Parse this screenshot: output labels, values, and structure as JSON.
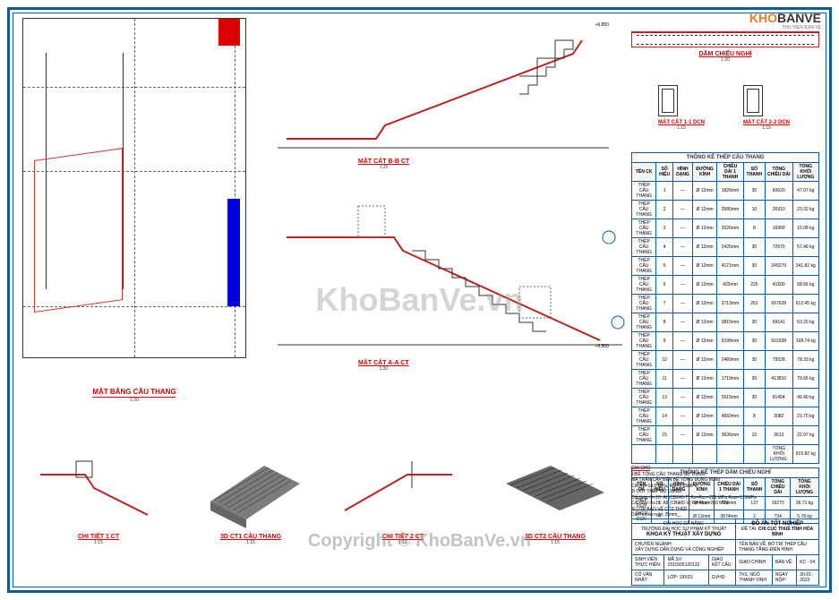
{
  "logo": {
    "part1": "KHO",
    "part2": "BANVE",
    "sub": "THU VIEN BAN VE"
  },
  "watermark1": "KhoBanVe.vn",
  "watermark2": "Copyright © KhoBanVe.vn",
  "plan": {
    "title": "MẶT BẰNG CẦU THANG",
    "scale": "1:20"
  },
  "section_bb": {
    "title": "MẶT CẮT B-B CT",
    "scale": "1:20"
  },
  "section_aa": {
    "title": "MẶT CẮT A-A CT",
    "scale": "1:20"
  },
  "beam": {
    "title": "DẦM CHIẾU NGHỈ",
    "scale": "1:20"
  },
  "sec11": {
    "title": "MẶT CẮT 1-1 DCN",
    "scale": "1:15"
  },
  "sec22": {
    "title": "MẶT CẮT 2-2 DCN",
    "scale": "1:15"
  },
  "detail1": {
    "title": "CHI TIẾT 1 CT",
    "scale": "1:15"
  },
  "detail_3d1": {
    "title": "3D CT1 CẦU THANG",
    "scale": "1:15"
  },
  "detail2": {
    "title": "CHI TIẾT 2 CT",
    "scale": "1:15"
  },
  "detail_3d2": {
    "title": "3D CT2 CẦU THANG",
    "scale": "1:15"
  },
  "level_top": "+6.850",
  "level_bot": "+3.500",
  "table1": {
    "title": "THỐNG KÊ THÉP CẦU THANG",
    "headers": [
      "TÊN CK",
      "SỐ HIỆU",
      "HÌNH DẠNG",
      "ĐƯỜNG KÍNH",
      "CHIỀU DÀI 1 THANH",
      "SỐ THANH",
      "TỔNG CHIỀU DÀI",
      "TỔNG KHỐI LƯỢNG"
    ],
    "rows": [
      [
        "THÉP CẤU THANG",
        "1",
        "—",
        "Ø 12mm",
        "1826mm",
        "30",
        "60620",
        "47.97 kg"
      ],
      [
        "THÉP CẤU THANG",
        "2",
        "—",
        "Ø 12mm",
        "2580mm",
        "10",
        "26910",
        "23.32 kg"
      ],
      [
        "THÉP CẤU THANG",
        "3",
        "—",
        "Ø 12mm",
        "2026mm",
        "8",
        "16990",
        "15.08 kg"
      ],
      [
        "THÉP CẤU THANG",
        "4",
        "—",
        "Ø 12mm",
        "2425mm",
        "30",
        "72670",
        "57.46 kg"
      ],
      [
        "THÉP CẤU THANG",
        "5",
        "—",
        "Ø 12mm",
        "4171mm",
        "30",
        "249270",
        "341.82 kg"
      ],
      [
        "THÉP CẤU THANG",
        "6",
        "—",
        "Ø 12mm",
        "420mm",
        "225",
        "41600",
        "68.56 kg"
      ],
      [
        "THÉP CẤU THANG",
        "7",
        "—",
        "Ø 12mm",
        "2713mm",
        "261",
        "697628",
        "612.45 kg"
      ],
      [
        "THÉP CẤU THANG",
        "8",
        "—",
        "Ø 12mm",
        "3815mm",
        "30",
        "69141",
        "63.20 kg"
      ],
      [
        "THÉP CẤU THANG",
        "9",
        "—",
        "Ø 12mm",
        "5198mm",
        "30",
        "601928",
        "168.74 kg"
      ],
      [
        "THÉP CẤU THANG",
        "10",
        "—",
        "Ø 12mm",
        "2489mm",
        "30",
        "79528",
        "78.33 kg"
      ],
      [
        "THÉP CẤU THANG",
        "11",
        "—",
        "Ø 12mm",
        "1719mm",
        "30",
        "413810",
        "70.65 kg"
      ],
      [
        "THÉP CẤU THANG",
        "13",
        "—",
        "Ø 12mm",
        "2615mm",
        "30",
        "81454",
        "46.40 kg"
      ],
      [
        "THÉP CẤU THANG",
        "14",
        "—",
        "Ø 12mm",
        "4560mm",
        "8",
        "3082",
        "23.70 kg"
      ],
      [
        "THÉP CẤU THANG",
        "15",
        "—",
        "Ø 12mm",
        "3636mm",
        "10",
        "3613",
        "22.97 kg"
      ],
      [
        "",
        "",
        "",
        "",
        "",
        "",
        "TỔNG KHỐI LƯỢNG:",
        "915.82 kg"
      ]
    ]
  },
  "table2": {
    "title": "THỐNG KÊ THÉP DẦM CHIẾU NGHỈ",
    "headers": [
      "TÊN CK",
      "SỐ HIỆU",
      "HÌNH DẠNG",
      "ĐƯỜNG KÍNH",
      "CHIỀU DÀI 1 THANH",
      "SỐ THANH",
      "TỔNG CHIỀU DÀI",
      "TỔNG KHỐI LƯỢNG"
    ],
    "rows": [
      [
        "THÉP DCN",
        "1",
        "—",
        "Ø 6mm",
        "720mm",
        "137",
        "16273",
        "36.71 kg"
      ],
      [
        "THÉP DCN",
        "4",
        "—",
        "Ø 12mm",
        "3874mm",
        "2",
        "734",
        "5.78 kg"
      ]
    ]
  },
  "notes": {
    "title": "GHI CHÚ",
    "lines": [
      "1/BÊ TÔNG CẦU THANG SỬ DỤNG:",
      "MA TRẬN CẤP BỀN BÊ TÔNG DÙNG M360",
      "Cốt Rb=14.5 MPa, Rbt=1.05MPa",
      "2/ CỐT THÉP SỬ DỤNG:",
      "Cốt thép Φ<10: AI (CB240-T) Rs=Rsc=225 MPa Rsw=175MPa",
      "Cốt thép Φ≥10: AII (CB300-V) Rs=Rsc=260 MPa",
      "3/ LỚP BẢO VỆ CỐT THÉP:",
      "Dầm chiếu nghỉ: 25mm"
    ]
  },
  "titleblock": {
    "uni": "ĐẠI HỌC ĐÀ NẴNG",
    "faculty": "TRƯỜNG ĐẠI HỌC SƯ PHẠM KỸ THUẬT",
    "dept": "KHOA KỸ THUẬT XÂY DỰNG",
    "project_label": "ĐỒ ÁN TỐT NGHIỆP",
    "topic_label": "ĐỀ TÀI:",
    "topic": "CHI CỤC THUẾ TỈNH HÒA BÌNH",
    "major_label": "CHUYÊN NGÀNH:",
    "major": "XÂY DỰNG DÂN DỤNG VÀ CÔNG NGHIỆP",
    "drawing_name_label": "TÊN BẢN VẼ:",
    "drawing_name": "BỐ TRÍ THÉP CẦU THANG TẦNG ĐIỂN HÌNH",
    "student_label": "SINH VIÊN THỰC HIỆN:",
    "msv_label": "MÃ SV:",
    "msv": "1911505120132",
    "task_label": "GIAO KẾT CẤU:",
    "task": "GIAO CHÍNH",
    "sheet_label": "BẢN VẼ:",
    "sheet": "KC - 04",
    "advisor_label": "CỐ VẤN NHẤT:",
    "class_label": "LỚP:",
    "class": "19XD1",
    "gvhd_label": "GVHD:",
    "gvhd": "ThS. NGÔ THANH VINH",
    "date_label": "NGÀY NỘP:",
    "date": "30-01-2023"
  }
}
